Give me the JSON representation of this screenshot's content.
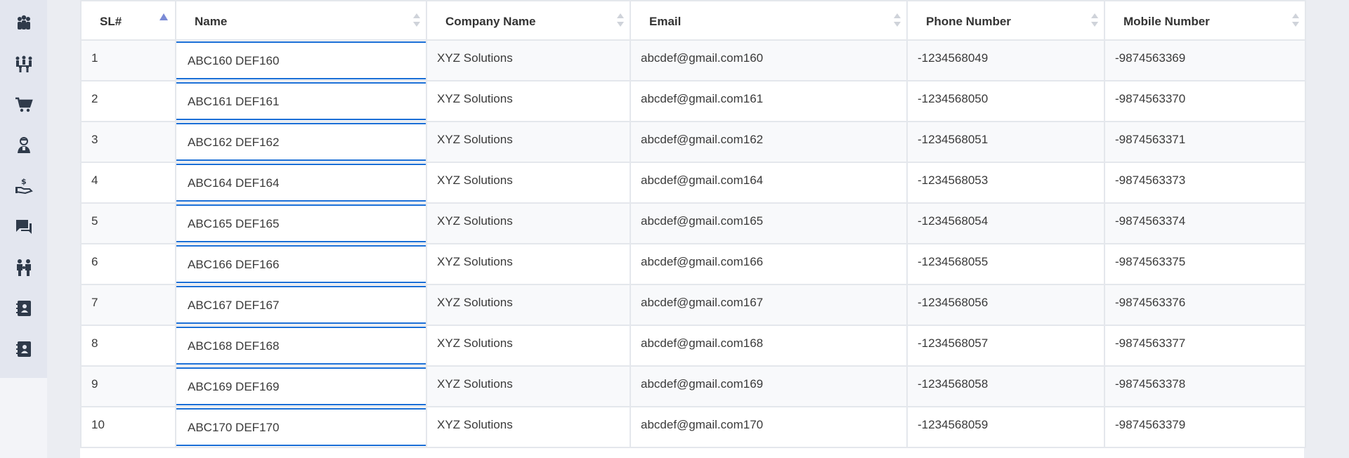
{
  "sidebar": {
    "items": [
      {
        "icon": "team-icon"
      },
      {
        "icon": "organization-icon"
      },
      {
        "icon": "cart-icon"
      },
      {
        "icon": "agent-icon"
      },
      {
        "icon": "payment-icon"
      },
      {
        "icon": "chat-icon"
      },
      {
        "icon": "family-icon"
      },
      {
        "icon": "contact-book-icon"
      },
      {
        "icon": "contact-book-icon"
      }
    ]
  },
  "table": {
    "columns": [
      "SL#",
      "Name",
      "Company Name",
      "Email",
      "Phone Number",
      "Mobile Number"
    ],
    "rows": [
      {
        "sl": "1",
        "name": "ABC160 DEF160",
        "company": "XYZ Solutions",
        "email": "abcdef@gmail.com160",
        "phone": "-1234568049",
        "mobile": "-9874563369"
      },
      {
        "sl": "2",
        "name": "ABC161 DEF161",
        "company": "XYZ Solutions",
        "email": "abcdef@gmail.com161",
        "phone": "-1234568050",
        "mobile": "-9874563370"
      },
      {
        "sl": "3",
        "name": "ABC162 DEF162",
        "company": "XYZ Solutions",
        "email": "abcdef@gmail.com162",
        "phone": "-1234568051",
        "mobile": "-9874563371"
      },
      {
        "sl": "4",
        "name": "ABC164 DEF164",
        "company": "XYZ Solutions",
        "email": "abcdef@gmail.com164",
        "phone": "-1234568053",
        "mobile": "-9874563373"
      },
      {
        "sl": "5",
        "name": "ABC165 DEF165",
        "company": "XYZ Solutions",
        "email": "abcdef@gmail.com165",
        "phone": "-1234568054",
        "mobile": "-9874563374"
      },
      {
        "sl": "6",
        "name": "ABC166 DEF166",
        "company": "XYZ Solutions",
        "email": "abcdef@gmail.com166",
        "phone": "-1234568055",
        "mobile": "-9874563375"
      },
      {
        "sl": "7",
        "name": "ABC167 DEF167",
        "company": "XYZ Solutions",
        "email": "abcdef@gmail.com167",
        "phone": "-1234568056",
        "mobile": "-9874563376"
      },
      {
        "sl": "8",
        "name": "ABC168 DEF168",
        "company": "XYZ Solutions",
        "email": "abcdef@gmail.com168",
        "phone": "-1234568057",
        "mobile": "-9874563377"
      },
      {
        "sl": "9",
        "name": "ABC169 DEF169",
        "company": "XYZ Solutions",
        "email": "abcdef@gmail.com169",
        "phone": "-1234568058",
        "mobile": "-9874563378"
      },
      {
        "sl": "10",
        "name": "ABC170 DEF170",
        "company": "XYZ Solutions",
        "email": "abcdef@gmail.com170",
        "phone": "-1234568059",
        "mobile": "-9874563379"
      }
    ],
    "sort_column": "SL#",
    "sort_direction": "ascending"
  },
  "colors": {
    "accent": "#1b6fd6",
    "sort_active": "#7b8bd6",
    "icon": "#2f3a4a",
    "background": "#ebedf2"
  }
}
